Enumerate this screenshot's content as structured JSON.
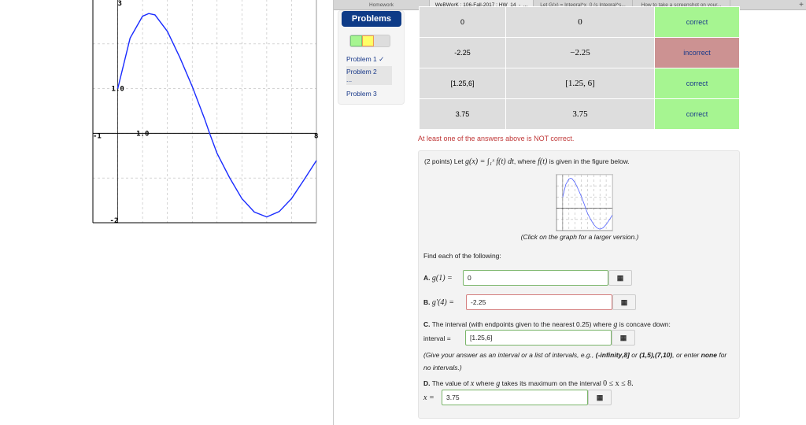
{
  "browser_tabs": [
    "Homework",
    "WeBWorK : 106-Fall-2017 : HW_14_-_...",
    "Let G(x) = Integral^x_0 (s Integral^s...",
    "How to take a screenshot on your...",
    "+"
  ],
  "sidebar": {
    "problems_button": "Problems",
    "items": [
      "Problem 1 ✓",
      "Problem 2",
      "...",
      "Problem 3"
    ],
    "progress": {
      "correct": 1,
      "partial": 1,
      "total": 3
    },
    "colors": {
      "correct": "#a6f591",
      "partial": "#ffff66"
    }
  },
  "results": [
    {
      "entered": "0",
      "preview": "0",
      "result": "correct"
    },
    {
      "entered": "-2.25",
      "preview": "−2.25",
      "result": "incorrect"
    },
    {
      "entered": "[1.25,6]",
      "preview": "[1.25, 6]",
      "result": "correct"
    },
    {
      "entered": "3.75",
      "preview": "3.75",
      "result": "correct"
    }
  ],
  "warning": "At least one of the answers above is NOT correct.",
  "problem": {
    "intro_points": "(2 points) Let",
    "intro_formula": "g(x) = ∫₁ˣ f(t) dt",
    "intro_mid": ", where",
    "intro_ft": "f(t)",
    "intro_end": "is given in the figure below.",
    "caption": "(Click on the graph for a larger version.)",
    "find": "Find each of the following:",
    "a_label": "A.",
    "a_expr": "g(1) =",
    "a_value": "0",
    "b_label": "B.",
    "b_expr": "g′(4) =",
    "b_value": "-2.25",
    "c_label": "C.",
    "c_text": "The interval (with endpoints given to the nearest 0.25) where",
    "c_g": "g",
    "c_text2": "is concave down:",
    "c_prefix": "interval =",
    "c_value": "[1.25,6]",
    "hint1": "(Give your answer as an interval or a list of intervals, e.g.,",
    "hint_ex1": "(-infinity,8]",
    "hint_or": "or",
    "hint_ex2": "(1,5),(7,10)",
    "hint_or2": ", or",
    "hint2a": "enter",
    "hint_none": "none",
    "hint2b": "for no intervals.)",
    "d_label": "D.",
    "d_text": "The value of",
    "d_x": "x",
    "d_text2": "where",
    "d_g": "g",
    "d_text3": "takes its maximum on the interval",
    "d_range": "0 ≤ x ≤ 8.",
    "d_prefix": "x =",
    "d_value": "3.75",
    "matrix_icon": "▦"
  },
  "chart_data": {
    "type": "line",
    "title": "f(t)",
    "xlim": [
      -1,
      8
    ],
    "ylim": [
      -2,
      3
    ],
    "tick_labels": {
      "xmin": "-1",
      "xmax": "8",
      "x1": "1.0",
      "y1": "1.0",
      "ymin": "-2",
      "ymax": "3"
    },
    "grid": true,
    "x": [
      0,
      0.5,
      1,
      1.25,
      1.5,
      2,
      2.5,
      3,
      3.5,
      3.7,
      4,
      4.5,
      5,
      5.5,
      6,
      6.5,
      7,
      7.5,
      8
    ],
    "y": [
      1,
      2.13,
      2.62,
      2.68,
      2.65,
      2.28,
      1.7,
      1.05,
      0.32,
      0,
      -0.45,
      -0.99,
      -1.46,
      -1.76,
      -1.87,
      -1.75,
      -1.46,
      -1.04,
      -0.61
    ],
    "color": "#1a2cff"
  }
}
